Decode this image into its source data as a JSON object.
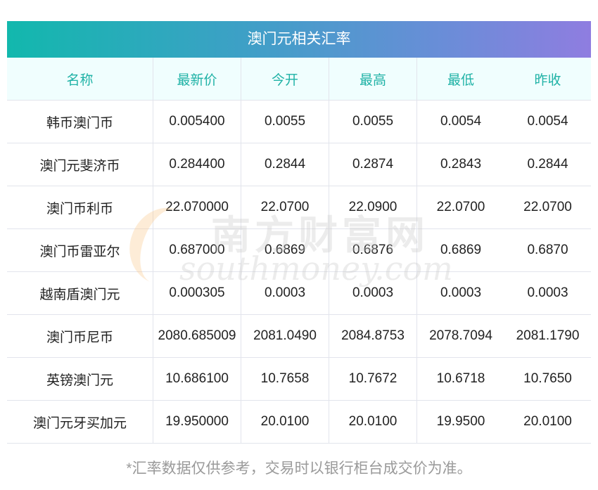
{
  "title": "澳门元相关汇率",
  "headers": [
    "名称",
    "最新价",
    "今开",
    "最高",
    "最低",
    "昨收"
  ],
  "rows": [
    [
      "韩币澳门币",
      "0.005400",
      "0.0055",
      "0.0055",
      "0.0054",
      "0.0054"
    ],
    [
      "澳门元斐济币",
      "0.284400",
      "0.2844",
      "0.2874",
      "0.2843",
      "0.2844"
    ],
    [
      "澳门币利币",
      "22.070000",
      "22.0700",
      "22.0900",
      "22.0700",
      "22.0700"
    ],
    [
      "澳门币雷亚尔",
      "0.687000",
      "0.6869",
      "0.6876",
      "0.6869",
      "0.6870"
    ],
    [
      "越南盾澳门元",
      "0.000305",
      "0.0003",
      "0.0003",
      "0.0003",
      "0.0003"
    ],
    [
      "澳门币尼币",
      "2080.685009",
      "2081.0490",
      "2084.8753",
      "2078.7094",
      "2081.1790"
    ],
    [
      "英镑澳门元",
      "10.686100",
      "10.7658",
      "10.7672",
      "10.6718",
      "10.7650"
    ],
    [
      "澳门元牙买加元",
      "19.950000",
      "20.0100",
      "20.0100",
      "19.9500",
      "20.0100"
    ]
  ],
  "footer": "*汇率数据仅供参考，交易时以银行柜台成交价为准。",
  "watermark": {
    "cn": "南方财富网",
    "en": "southmoney.com"
  },
  "colors": {
    "header_text": "#1fb2a6",
    "gradient_start": "#12b8ad",
    "gradient_end": "#8f7de0"
  }
}
